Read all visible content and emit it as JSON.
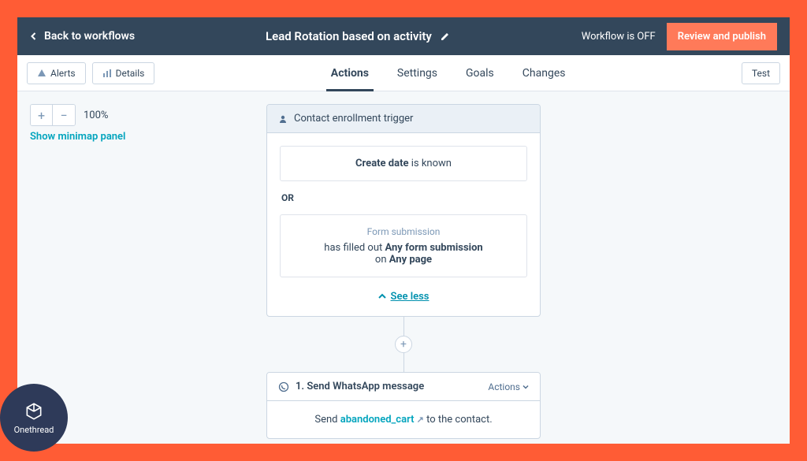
{
  "header": {
    "back": "Back to workflows",
    "title": "Lead Rotation based on activity",
    "status": "Workflow is OFF",
    "review": "Review and publish"
  },
  "toolbar": {
    "alerts": "Alerts",
    "details": "Details",
    "test": "Test"
  },
  "tabs": [
    "Actions",
    "Settings",
    "Goals",
    "Changes"
  ],
  "zoom": {
    "pct": "100%",
    "minimap": "Show minimap panel"
  },
  "trigger": {
    "title": "Contact enrollment trigger",
    "crit1_b": "Create date",
    "crit1_r": " is known",
    "or": "OR",
    "crit2_sub": "Form submission",
    "crit2_a": "has filled out ",
    "crit2_b": "Any form submission",
    "crit2_c": "on ",
    "crit2_d": "Any page",
    "seeless": "See less"
  },
  "action1": {
    "title": "1. Send WhatsApp message",
    "menu": "Actions",
    "body_a": "Send ",
    "body_tpl": "abandoned_cart",
    "body_b": " to the contact."
  },
  "brand": "Onethread"
}
